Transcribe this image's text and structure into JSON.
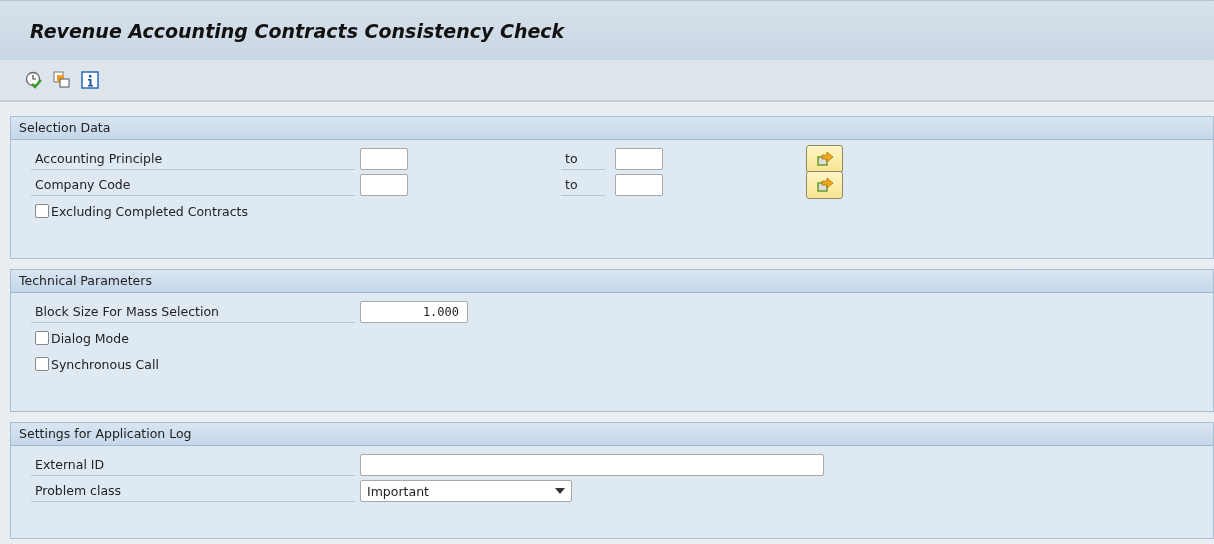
{
  "window": {
    "title": "Revenue Accounting Contracts Consistency Check"
  },
  "sections": [
    {
      "title": "Selection Data",
      "rows": [
        {
          "kind": "range",
          "label": "Accounting Principle",
          "to_label": "to"
        },
        {
          "kind": "range",
          "label": "Company Code",
          "to_label": "to"
        },
        {
          "kind": "checkbox",
          "label": "Excluding Completed Contracts",
          "checked": false
        }
      ]
    },
    {
      "title": "Technical Parameters",
      "rows": [
        {
          "kind": "input",
          "label": "Block Size For Mass Selection",
          "value": "1.000"
        },
        {
          "kind": "checkbox",
          "label": "Dialog Mode",
          "checked": false
        },
        {
          "kind": "checkbox",
          "label": "Synchronous Call",
          "checked": false
        }
      ]
    },
    {
      "title": "Settings for Application Log",
      "rows": [
        {
          "kind": "text",
          "label": "External ID"
        },
        {
          "kind": "dropdown",
          "label": "Problem class",
          "value": "Important"
        }
      ]
    }
  ]
}
